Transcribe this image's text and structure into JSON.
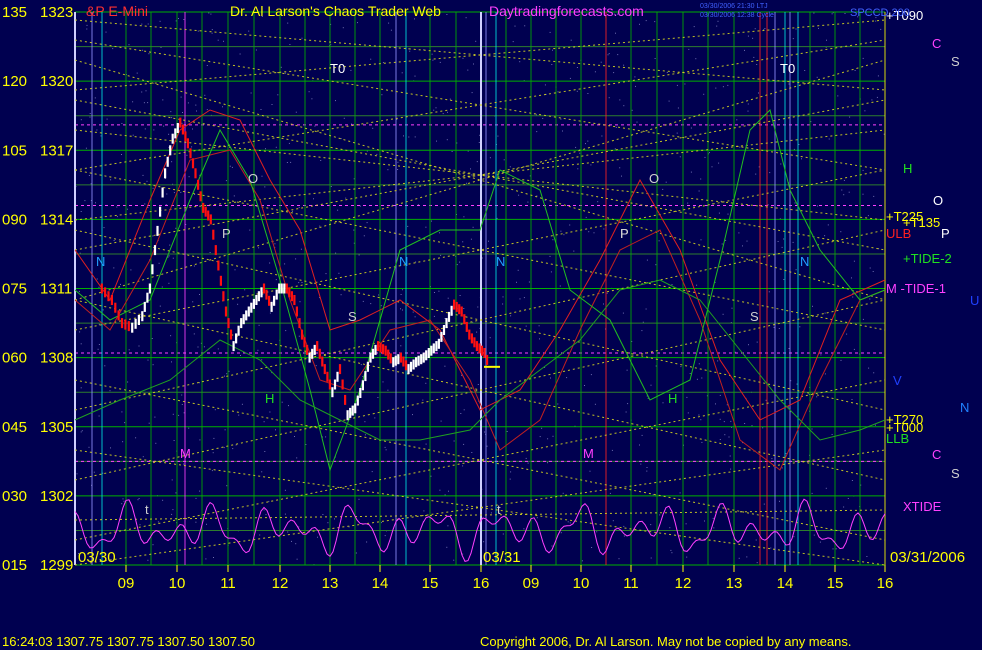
{
  "header": {
    "symbol_fragment": "&P E-Mini",
    "title": "Dr. Al Larson's Chaos Trader Web",
    "site": "Daytradingforecasts.com",
    "tiny_left_1": "03/30/2006 21:30 LTJ",
    "tiny_left_2": "03/30/2006 12:38 Cycle",
    "tiny_right": "SPCCD 200"
  },
  "footer": {
    "quote": "16:24:03  1307.75  1307.75  1307.50  1307.50",
    "copyright": "Copyright 2006, Dr. Al Larson. May not be copied by any means."
  },
  "colors": {
    "background": "#000050",
    "grid_green": "#00b000",
    "price_up": "#ffffff",
    "price_down": "#ff1010",
    "dotted_yellow": "#d8d820",
    "cycle_magenta": "#ff40ff",
    "label_yellow": "#ffff00"
  },
  "chart_data": {
    "type": "line",
    "title": "S&P E-Mini",
    "xlabel": "",
    "ylabel": "",
    "y_axis_left": [
      {
        "osc": "135",
        "price": "1323"
      },
      {
        "osc": "120",
        "price": "1320"
      },
      {
        "osc": "105",
        "price": "1317"
      },
      {
        "osc": "090",
        "price": "1314"
      },
      {
        "osc": "075",
        "price": "1311"
      },
      {
        "osc": "060",
        "price": "1308"
      },
      {
        "osc": "045",
        "price": "1305"
      },
      {
        "osc": "030",
        "price": "1302"
      },
      {
        "osc": "015",
        "price": "1299"
      }
    ],
    "ylim": [
      1299,
      1323
    ],
    "x_tick_labels": [
      "09",
      "10",
      "11",
      "12",
      "13",
      "14",
      "15",
      "16",
      "09",
      "10",
      "11",
      "12",
      "13",
      "14",
      "15",
      "16"
    ],
    "x_range_hours": [
      8.5,
      24.3
    ],
    "date_labels": [
      {
        "text": "03/30",
        "at": 8.6
      },
      {
        "text": "03/31",
        "at": 16.3
      },
      {
        "text": "03/31/2006",
        "at": 24.3
      }
    ],
    "price_series": {
      "name": "S&P E-Mini",
      "x": [
        8.5,
        8.7,
        8.9,
        9.1,
        9.3,
        9.45,
        9.6,
        9.75,
        9.9,
        10.05,
        10.2,
        10.35,
        10.5,
        10.65,
        10.8,
        10.95,
        11.1,
        11.25,
        11.4,
        11.55,
        11.7,
        11.85,
        12.0,
        12.15,
        12.3,
        12.45,
        12.6,
        12.75,
        12.9,
        13.05,
        13.2,
        13.35,
        13.5,
        13.65,
        13.8,
        13.95,
        14.1,
        14.25,
        14.4,
        14.55,
        14.7,
        14.85,
        15.0,
        15.15,
        15.3,
        15.45,
        15.6,
        15.75,
        15.9,
        16.05,
        16.15
      ],
      "y": [
        1311.0,
        1310.5,
        1309.5,
        1309.3,
        1309.8,
        1311.0,
        1313.5,
        1316.0,
        1317.5,
        1318.2,
        1317.3,
        1316.0,
        1314.5,
        1314.0,
        1312.0,
        1310.0,
        1308.5,
        1309.5,
        1310.0,
        1310.5,
        1311.0,
        1310.2,
        1311.0,
        1311.0,
        1310.5,
        1309.0,
        1308.0,
        1308.5,
        1307.5,
        1306.5,
        1307.5,
        1305.5,
        1305.8,
        1306.8,
        1308.0,
        1308.5,
        1308.3,
        1307.8,
        1308.0,
        1307.5,
        1307.8,
        1308.0,
        1308.3,
        1308.6,
        1309.5,
        1310.3,
        1310.0,
        1309.0,
        1308.5,
        1308.2,
        1307.6
      ]
    },
    "annotations": {
      "right_labels": [
        "+T090",
        "C",
        "S",
        "H",
        "O",
        "P",
        "+T225",
        "+T135",
        "ULB",
        "+TIDE-2",
        "M -TIDE-1",
        "U",
        "V",
        "+T270",
        "N",
        "+T000",
        "LLB",
        "C",
        "S",
        "XTIDE"
      ],
      "markers": [
        "T0",
        "T0",
        "N",
        "O",
        "P",
        "S",
        "N",
        "P",
        "H",
        "M",
        "t",
        "N",
        "O",
        "P",
        "S",
        "N",
        "H",
        "M",
        "t"
      ]
    }
  }
}
